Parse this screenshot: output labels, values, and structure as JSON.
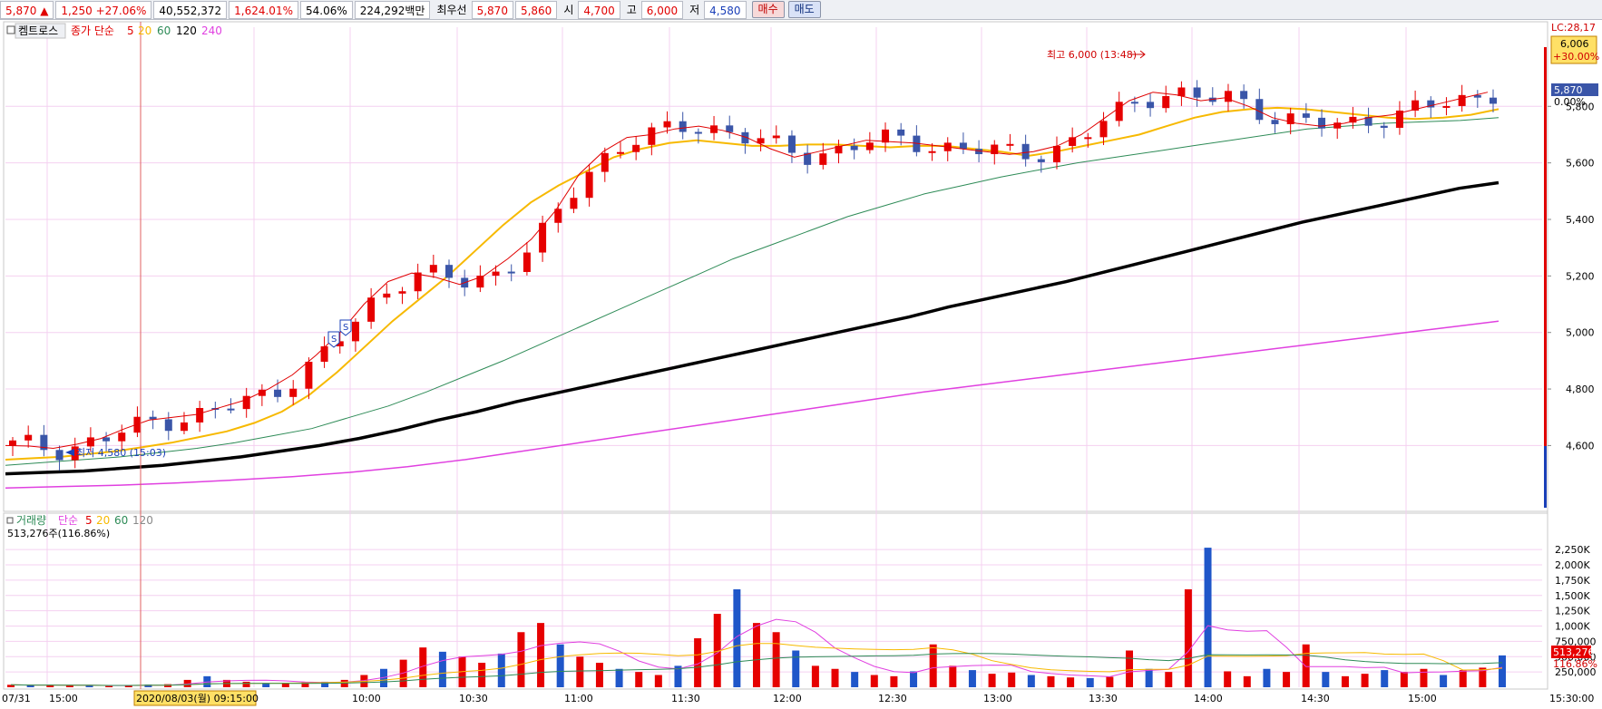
{
  "topbar": {
    "price": "5,870",
    "change_arrow": "▲",
    "change": "1,250",
    "change_pct": "+27.06%",
    "volume": "40,552,372",
    "volume_pct": "1,624.01%",
    "turnover_pct": "54.06%",
    "amount": "224,292백만",
    "best_label": "최우선",
    "best_ask": "5,870",
    "best_bid": "5,860",
    "open_label": "시",
    "open": "4,700",
    "high_label": "고",
    "high": "6,000",
    "low_label": "저",
    "low": "4,580",
    "buy_button": "매수",
    "sell_button": "매도"
  },
  "price_panel": {
    "stock_name": "켐트로스",
    "legend_prefix": "종가 단순",
    "ma_labels": [
      "5",
      "20",
      "60",
      "120",
      "240"
    ],
    "ma_colors": [
      "#e00000",
      "#f7b900",
      "#2e8b57",
      "#000000",
      "#e040e0"
    ],
    "high_annotation": "최고 6,000 (13:48)",
    "low_annotation": "최저 4,580 (15:03)",
    "limit_label": "LC:28,17",
    "upper_box_price": "6,006",
    "upper_box_pct": "+30.00%",
    "current_tag": "5,870",
    "current_pct": "0.00%",
    "signal_glyph": "S"
  },
  "volume_panel": {
    "title": "거래량",
    "legend_prefix": "단순",
    "ma_labels": [
      "5",
      "20",
      "60",
      "120"
    ],
    "ma_colors": [
      "#e00000",
      "#f7b900",
      "#2e8b57",
      "#888888"
    ],
    "current_text": "513,276주(116.86%)",
    "tag_value": "513,276",
    "tag_pct": "116.86%"
  },
  "x_axis": {
    "date_left": "07/31",
    "crosshair_label": "2020/08/03(월) 09:15:00",
    "end_label": "15:30:00"
  },
  "colors": {
    "up": "#e60000",
    "down": "#3a55a8",
    "vol_up": "#e60000",
    "vol_down": "#1f56c9"
  },
  "chart_data": [
    {
      "type": "candlestick",
      "title": "켐트로스",
      "x_ticks": [
        "15:00",
        "09:30",
        "10:00",
        "10:30",
        "11:00",
        "11:30",
        "12:00",
        "12:30",
        "13:00",
        "13:30",
        "14:00",
        "14:30",
        "15:00"
      ],
      "y_ticks": [
        4600,
        4800,
        5000,
        5200,
        5400,
        5600,
        5800
      ],
      "ylim": [
        4380,
        6080
      ],
      "moving_averages": [
        "5",
        "20",
        "60",
        "120",
        "240"
      ],
      "series": [
        {
          "name": "5",
          "values": [
            4600,
            4598,
            4590,
            4605,
            4625,
            4660,
            4690,
            4700,
            4710,
            4735,
            4760,
            4800,
            4850,
            4920,
            5000,
            5100,
            5180,
            5210,
            5195,
            5170,
            5200,
            5260,
            5330,
            5430,
            5560,
            5640,
            5690,
            5700,
            5720,
            5730,
            5715,
            5690,
            5650,
            5620,
            5640,
            5660,
            5680,
            5675,
            5670,
            5660,
            5650,
            5640,
            5630,
            5640,
            5660,
            5700,
            5760,
            5820,
            5850,
            5840,
            5820,
            5830,
            5800,
            5760,
            5740,
            5730,
            5740,
            5760,
            5770,
            5790,
            5810,
            5830,
            5850
          ]
        },
        {
          "name": "20",
          "values": [
            4550,
            4555,
            4560,
            4570,
            4580,
            4595,
            4610,
            4630,
            4650,
            4680,
            4720,
            4780,
            4860,
            4950,
            5040,
            5120,
            5200,
            5290,
            5380,
            5460,
            5520,
            5570,
            5620,
            5650,
            5670,
            5680,
            5670,
            5660,
            5660,
            5665,
            5665,
            5660,
            5655,
            5660,
            5660,
            5650,
            5640,
            5625,
            5640,
            5660,
            5680,
            5700,
            5730,
            5760,
            5780,
            5790,
            5795,
            5790,
            5780,
            5770,
            5760,
            5755,
            5760,
            5770,
            5790
          ]
        },
        {
          "name": "60",
          "values": [
            4530,
            4540,
            4550,
            4560,
            4575,
            4590,
            4610,
            4635,
            4660,
            4700,
            4740,
            4790,
            4845,
            4900,
            4960,
            5020,
            5080,
            5140,
            5200,
            5260,
            5310,
            5360,
            5410,
            5450,
            5490,
            5520,
            5550,
            5575,
            5600,
            5620,
            5640,
            5660,
            5680,
            5700,
            5720,
            5730,
            5740,
            5745,
            5750,
            5760
          ]
        },
        {
          "name": "120",
          "values": [
            4500,
            4505,
            4510,
            4520,
            4530,
            4545,
            4560,
            4580,
            4600,
            4625,
            4655,
            4690,
            4720,
            4755,
            4785,
            4815,
            4845,
            4875,
            4905,
            4935,
            4965,
            4995,
            5025,
            5055,
            5090,
            5120,
            5150,
            5180,
            5215,
            5250,
            5285,
            5320,
            5355,
            5390,
            5420,
            5450,
            5480,
            5510,
            5530
          ]
        },
        {
          "name": "240",
          "values": [
            4450,
            4455,
            4460,
            4468,
            4478,
            4490,
            4505,
            4525,
            4550,
            4580,
            4610,
            4640,
            4670,
            4700,
            4730,
            4760,
            4790,
            4815,
            4840,
            4865,
            4890,
            4915,
            4940,
            4965,
            4990,
            5015,
            5040
          ]
        }
      ],
      "candles_note": "intraday price candles, last close 5,870"
    },
    {
      "type": "bar",
      "title": "거래량",
      "y_ticks": [
        "250,000",
        "500,000",
        "750,000",
        "1,000K",
        "1,250K",
        "1,500K",
        "1,750K",
        "2,000K",
        "2,250K"
      ],
      "ylim": [
        0,
        2400000
      ],
      "series": [
        {
          "name": "volume",
          "values": [
            40000,
            30000,
            35000,
            30000,
            25000,
            20000,
            30000,
            45000,
            50000,
            120000,
            180000,
            120000,
            90000,
            70000,
            60000,
            80000,
            90000,
            120000,
            200000,
            300000,
            450000,
            650000,
            580000,
            500000,
            400000,
            550000,
            900000,
            1050000,
            700000,
            500000,
            400000,
            300000,
            250000,
            200000,
            350000,
            800000,
            1200000,
            1600000,
            1050000,
            900000,
            600000,
            350000,
            300000,
            250000,
            200000,
            180000,
            260000,
            700000,
            350000,
            280000,
            220000,
            240000,
            200000,
            180000,
            160000,
            150000,
            170000,
            600000,
            300000,
            250000,
            1600000,
            2280000,
            260000,
            180000,
            300000,
            250000,
            700000,
            250000,
            180000,
            220000,
            280000,
            250000,
            300000,
            200000,
            280000,
            320000,
            520000
          ]
        }
      ]
    }
  ]
}
